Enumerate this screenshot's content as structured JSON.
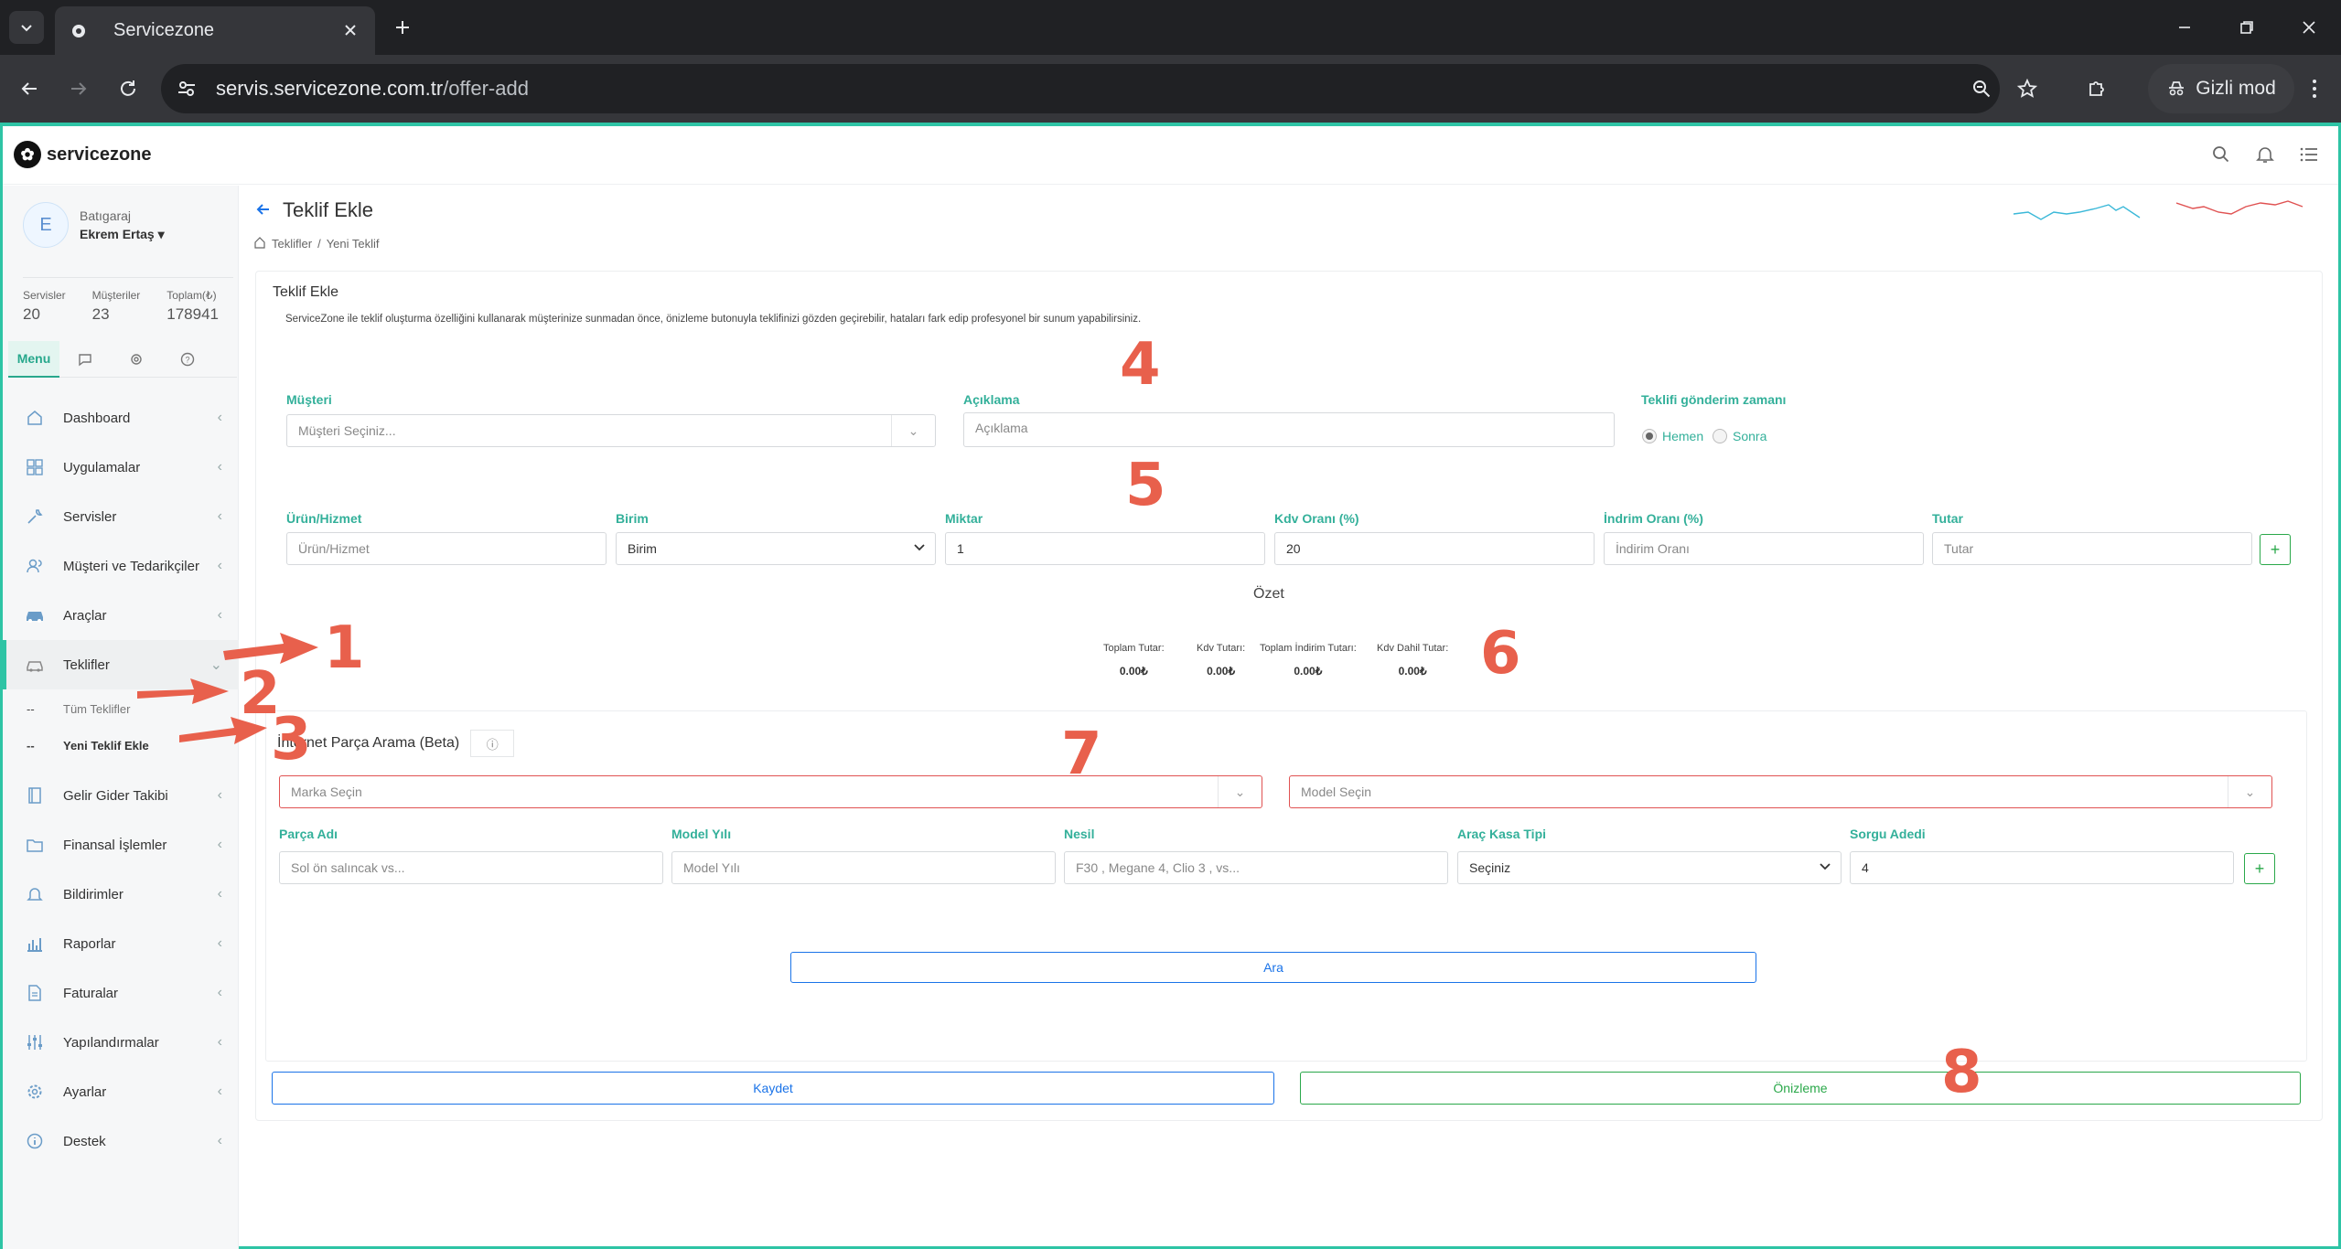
{
  "browser": {
    "tab_title": "Servicezone",
    "url_host": "servis.servicezone.com.tr",
    "url_path": "/offer-add",
    "incognito_label": "Gizli mod"
  },
  "app": {
    "brand": "servicezone"
  },
  "sidebar": {
    "user_role": "Batıgaraj",
    "user_name": "Ekrem Ertaş",
    "avatar_letter": "E",
    "stats": [
      {
        "label": "Servisler",
        "value": "20"
      },
      {
        "label": "Müşteriler",
        "value": "23"
      },
      {
        "label": "Toplam(₺)",
        "value": "178941"
      }
    ],
    "tab_menu": "Menu",
    "items": [
      {
        "label": "Dashboard",
        "icon": "home-icon"
      },
      {
        "label": "Uygulamalar",
        "icon": "grid-icon"
      },
      {
        "label": "Servisler",
        "icon": "wrench-icon"
      },
      {
        "label": "Müşteri ve Tedarikçiler",
        "icon": "users-icon"
      },
      {
        "label": "Araçlar",
        "icon": "car-icon"
      },
      {
        "label": "Teklifler",
        "icon": "offer-car-icon"
      },
      {
        "label": "Gelir Gider Takibi",
        "icon": "book-icon"
      },
      {
        "label": "Finansal İşlemler",
        "icon": "folder-icon"
      },
      {
        "label": "Bildirimler",
        "icon": "bell-icon"
      },
      {
        "label": "Raporlar",
        "icon": "bar-chart-icon"
      },
      {
        "label": "Faturalar",
        "icon": "file-icon"
      },
      {
        "label": "Yapılandırmalar",
        "icon": "sliders-icon"
      },
      {
        "label": "Ayarlar",
        "icon": "gear-icon"
      },
      {
        "label": "Destek",
        "icon": "info-icon"
      }
    ],
    "sub_items": [
      {
        "dash": "--",
        "label": "Tüm Teklifler"
      },
      {
        "dash": "--",
        "label": "Yeni Teklif Ekle"
      }
    ]
  },
  "header": {
    "title": "Teklif Ekle",
    "breadcrumb": [
      "Teklifler",
      "/",
      "Yeni Teklif"
    ]
  },
  "form": {
    "card_title": "Teklif Ekle",
    "description": "ServiceZone ile teklif oluşturma özelliğini kullanarak müşterinize sunmadan önce, önizleme butonuyla teklifinizi gözden geçirebilir, hataları fark edip profesyonel bir sunum yapabilirsiniz.",
    "musteri_label": "Müşteri",
    "musteri_placeholder": "Müşteri Seçiniz...",
    "aciklama_label": "Açıklama",
    "aciklama_placeholder": "Açıklama",
    "zaman_label": "Teklifi gönderim zamanı",
    "radio_hemen": "Hemen",
    "radio_sonra": "Sonra",
    "urun_label": "Ürün/Hizmet",
    "urun_placeholder": "Ürün/Hizmet",
    "birim_label": "Birim",
    "birim_value": "Birim",
    "miktar_label": "Miktar",
    "miktar_value": "1",
    "kdv_label": "Kdv Oranı (%)",
    "kdv_value": "20",
    "indirim_label": "İndrim Oranı (%)",
    "indirim_placeholder": "İndirim Oranı",
    "tutar_label": "Tutar",
    "tutar_placeholder": "Tutar",
    "plus": "+"
  },
  "summary": {
    "title": "Özet",
    "items": [
      {
        "label": "Toplam Tutar:",
        "value": "0.00₺"
      },
      {
        "label": "Kdv Tutarı:",
        "value": "0.00₺"
      },
      {
        "label": "Toplam İndirim Tutarı:",
        "value": "0.00₺"
      },
      {
        "label": "Kdv Dahil Tutar:",
        "value": "0.00₺"
      }
    ]
  },
  "parts_search": {
    "title": "İnternet Parça Arama (Beta)",
    "brand_placeholder": "Marka Seçin",
    "model_placeholder": "Model Seçin",
    "parca_label": "Parça Adı",
    "parca_placeholder": "Sol ön salıncak vs...",
    "yil_label": "Model Yılı",
    "yil_placeholder": "Model Yılı",
    "nesil_label": "Nesil",
    "nesil_placeholder": "F30 , Megane 4, Clio 3 , vs...",
    "kasa_label": "Araç Kasa Tipi",
    "kasa_value": "Seçiniz",
    "sorgu_label": "Sorgu Adedi",
    "sorgu_value": "4",
    "search_button": "Ara"
  },
  "actions": {
    "save": "Kaydet",
    "preview": "Önizleme"
  },
  "annotations": [
    "1",
    "2",
    "3",
    "4",
    "5",
    "6",
    "7",
    "8"
  ],
  "colors": {
    "accent": "#2ec4a5",
    "label_green": "#33b09a",
    "primary_blue": "#1a73e8",
    "success_green": "#2aa84a",
    "annotation": "#e8604c",
    "spark_blue": "#3ab8d8",
    "spark_red": "#e05252"
  }
}
